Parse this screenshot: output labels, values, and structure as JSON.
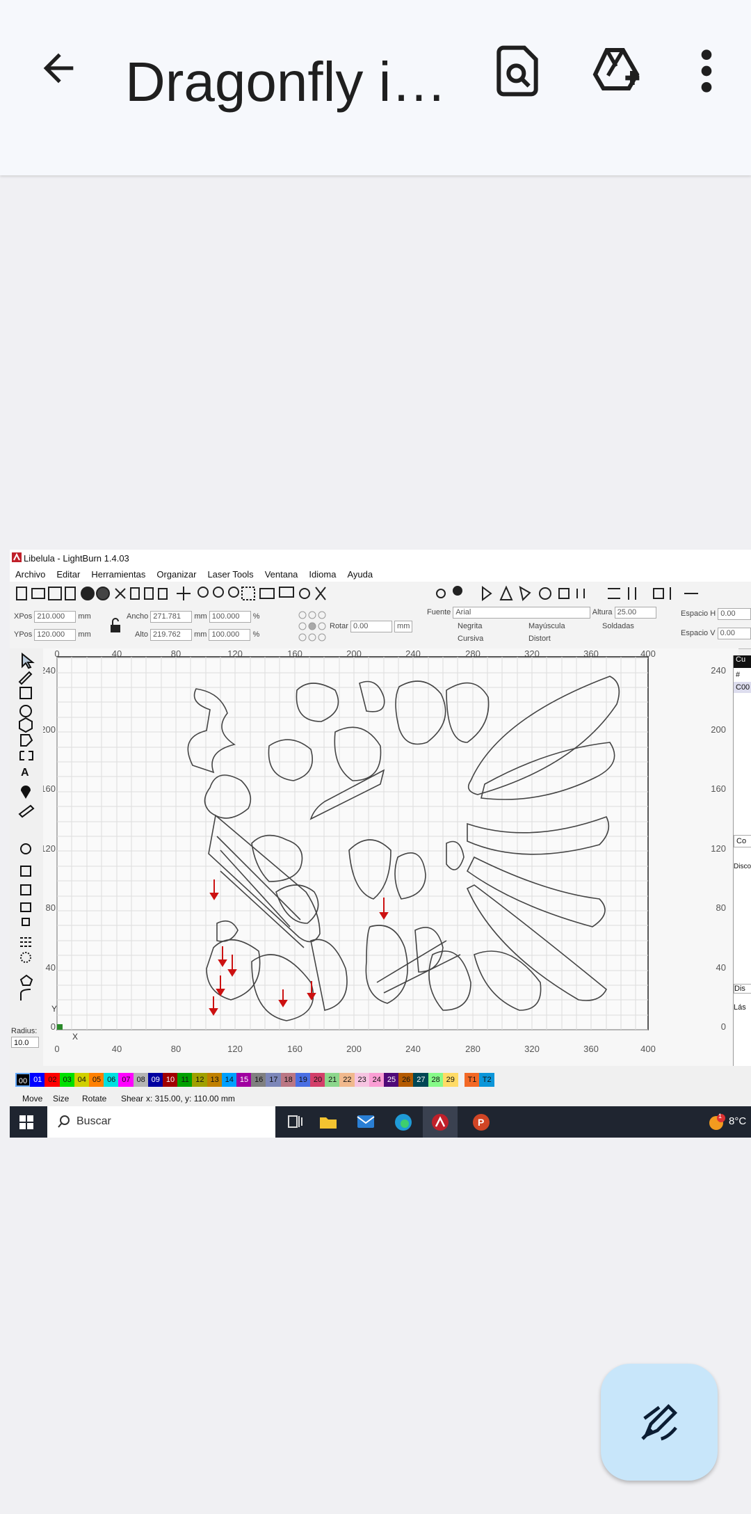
{
  "header": {
    "title": "Dragonfly i…",
    "icons": [
      "back-arrow-icon",
      "document-search-icon",
      "add-to-drive-icon",
      "more-vert-icon"
    ]
  },
  "screenshot": {
    "window_title": "Libelula - LightBurn 1.4.03",
    "menu": [
      "Archivo",
      "Editar",
      "Herramientas",
      "Organizar",
      "Laser Tools",
      "Ventana",
      "Idioma",
      "Ayuda"
    ],
    "props": {
      "xpos_label": "XPos",
      "xpos_value": "210.000",
      "ypos_label": "YPos",
      "ypos_value": "120.000",
      "unit_mm": "mm",
      "width_label": "Ancho",
      "width_value": "271.781",
      "height_label": "Alto",
      "height_value": "219.762",
      "scale_w": "100.000",
      "scale_h": "100.000",
      "percent": "%",
      "rotate_label": "Rotar",
      "rotate_value": "0.00",
      "mm_button": "mm",
      "font_label": "Fuente",
      "font_value": "Arial",
      "height2_label": "Altura",
      "height2_value": "25.00",
      "spaceh_label": "Espacio H",
      "spaceh_value": "0.00",
      "spacev_label": "Espacio V",
      "spacev_value": "0.00",
      "bold": "Negrita",
      "italic": "Cursiva",
      "upper": "Mayúscula",
      "distort": "Distort",
      "welded": "Soldadas"
    },
    "radius_label": "Radius:",
    "radius_value": "10.0",
    "ruler_x": [
      "0",
      "40",
      "80",
      "120",
      "160",
      "200",
      "240",
      "280",
      "320",
      "360",
      "400"
    ],
    "ruler_y_left": [
      "240",
      "200",
      "160",
      "120",
      "80",
      "40",
      "0"
    ],
    "ruler_y_right": [
      "240",
      "200",
      "160",
      "120",
      "80",
      "40",
      "0"
    ],
    "axis_x": "X",
    "axis_y": "Y",
    "right_panel": {
      "header": "Cu",
      "hash": "#",
      "row": "C00",
      "tab": "Co",
      "disc": "Disco",
      "dis": "Dis",
      "las": "Lás"
    },
    "palette": [
      {
        "label": "00",
        "color": "#000000"
      },
      {
        "label": "01",
        "color": "#0000ff"
      },
      {
        "label": "02",
        "color": "#ff0000"
      },
      {
        "label": "03",
        "color": "#00e000"
      },
      {
        "label": "04",
        "color": "#d0d000"
      },
      {
        "label": "05",
        "color": "#ff8000"
      },
      {
        "label": "06",
        "color": "#00e0e0"
      },
      {
        "label": "07",
        "color": "#ff00ff"
      },
      {
        "label": "08",
        "color": "#b4b4b4"
      },
      {
        "label": "09",
        "color": "#0000a0"
      },
      {
        "label": "10",
        "color": "#a00000"
      },
      {
        "label": "11",
        "color": "#00a000"
      },
      {
        "label": "12",
        "color": "#a0a000"
      },
      {
        "label": "13",
        "color": "#c08000"
      },
      {
        "label": "14",
        "color": "#00a0ff"
      },
      {
        "label": "15",
        "color": "#a000a0"
      },
      {
        "label": "16",
        "color": "#808080"
      },
      {
        "label": "17",
        "color": "#7d87b9"
      },
      {
        "label": "18",
        "color": "#bb7784"
      },
      {
        "label": "19",
        "color": "#4a6fe3"
      },
      {
        "label": "20",
        "color": "#d33f6a"
      },
      {
        "label": "21",
        "color": "#8cd78c"
      },
      {
        "label": "22",
        "color": "#f0b98d"
      },
      {
        "label": "23",
        "color": "#f6c4e1"
      },
      {
        "label": "24",
        "color": "#fa9ed4"
      },
      {
        "label": "25",
        "color": "#500a78"
      },
      {
        "label": "26",
        "color": "#b45a00"
      },
      {
        "label": "27",
        "color": "#004754"
      },
      {
        "label": "28",
        "color": "#86fa88"
      },
      {
        "label": "29",
        "color": "#ffdb66"
      },
      {
        "label": "T1",
        "color": "#f36926"
      },
      {
        "label": "T2",
        "color": "#0c96d9"
      }
    ],
    "status": {
      "move": "Move",
      "size": "Size",
      "rotate": "Rotate",
      "shear": "Shear",
      "coords": "x: 315.00, y: 110.00 mm"
    },
    "taskbar": {
      "search": "Buscar",
      "temperature": "8°C",
      "badge": "1"
    }
  },
  "fab_icon": "edit-pen-icon"
}
